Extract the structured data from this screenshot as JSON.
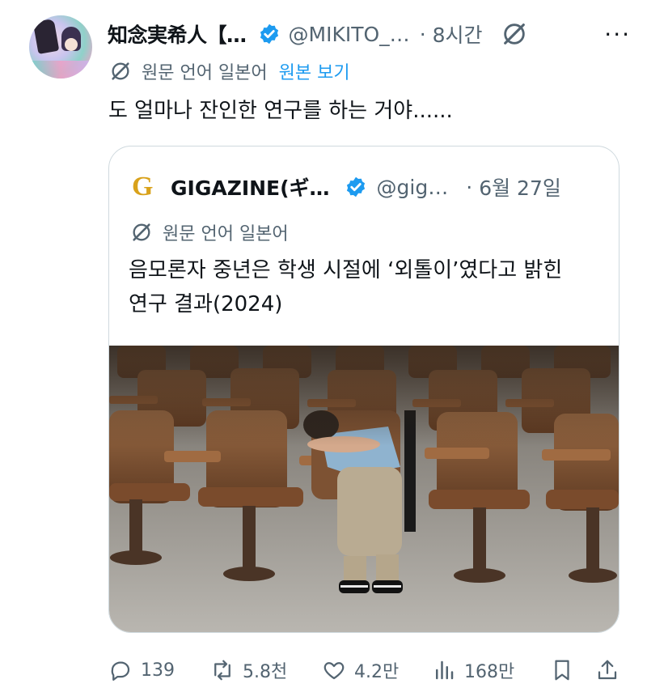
{
  "tweet": {
    "author_name": "知念実希人【…",
    "handle": "@MIKITO_…",
    "separator": "·",
    "time": "8시간",
    "more": "···",
    "translation_note": "원문 언어 일본어",
    "show_original": "원본 보기",
    "text": "도 얼마나 잔인한 연구를 하는 거야......"
  },
  "quote": {
    "logo_letter": "G",
    "author_name": "GIGAZINE(ギ…",
    "handle": "@gig…",
    "separator": "·",
    "time": "6월 27일",
    "translation_note": "원문 언어 일본어",
    "text_line1": "음모론자 중년은 학생 시절에 ‘외톨이’였다고 밝힌",
    "text_line2": "연구 결과(2024)"
  },
  "actions": {
    "replies": "139",
    "retweets": "5.8천",
    "likes": "4.2만",
    "views": "168만"
  },
  "colors": {
    "verified": "#1d9bf0",
    "link": "#1d9bf0",
    "secondary_text": "#536471",
    "logo": "#d9a21b"
  },
  "icons": [
    "verified-badge-icon",
    "grok-icon",
    "more-icon",
    "translate-icon",
    "reply-icon",
    "retweet-icon",
    "like-icon",
    "views-icon",
    "bookmark-icon",
    "share-icon"
  ]
}
